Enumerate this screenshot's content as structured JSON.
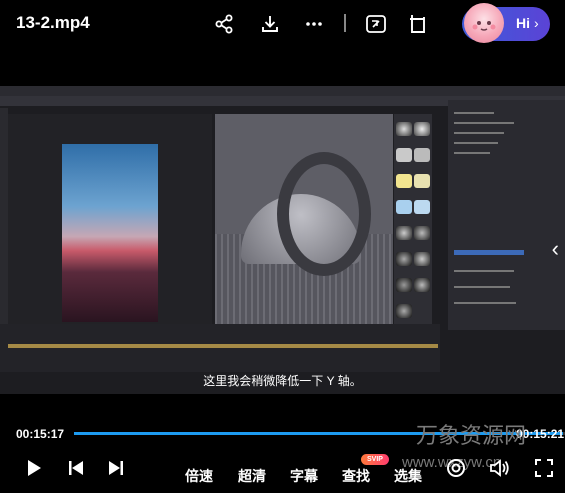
{
  "header": {
    "title": "13-2.mp4",
    "assistant_label": "Hi",
    "icons": [
      "share-icon",
      "download-icon",
      "more-icon",
      "screen-toggle-icon",
      "picture-in-picture-icon"
    ]
  },
  "video": {
    "subtitle": "这里我会稍微降低一下 Y 轴。"
  },
  "player": {
    "current_time": "00:15:17",
    "total_time": "00:15:21",
    "progress": 0.996,
    "controls": {
      "speed": "倍速",
      "quality": "超清",
      "subtitles": "字幕",
      "search": "查找",
      "search_badge": "SVIP",
      "episodes": "选集"
    }
  },
  "watermark": {
    "cn": "万象资源网",
    "url": "www.wxzyw.cn"
  },
  "colors": {
    "accent": "#1d9bf0",
    "background": "#000000",
    "assistant_bg": "#4a4fd8"
  }
}
